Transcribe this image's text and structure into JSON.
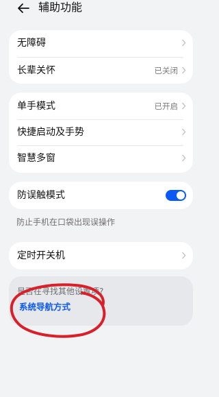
{
  "header": {
    "title": "辅助功能"
  },
  "group1": [
    {
      "label": "无障碍",
      "value": ""
    },
    {
      "label": "长辈关怀",
      "value": "已关闭"
    }
  ],
  "group2": [
    {
      "label": "单手模式",
      "value": "已开启"
    },
    {
      "label": "快捷启动及手势",
      "value": ""
    },
    {
      "label": "智慧多窗",
      "value": ""
    }
  ],
  "accidental": {
    "label": "防误触模式",
    "enabled": true,
    "hint": "防止手机在口袋出现误操作"
  },
  "scheduled": {
    "label": "定时开关机"
  },
  "suggestion": {
    "question": "是否在寻找其他设置项?",
    "link": "系统导航方式"
  },
  "colors": {
    "accent": "#0a59f7",
    "annotation": "#d8202a",
    "background": "#f1f3f5"
  }
}
